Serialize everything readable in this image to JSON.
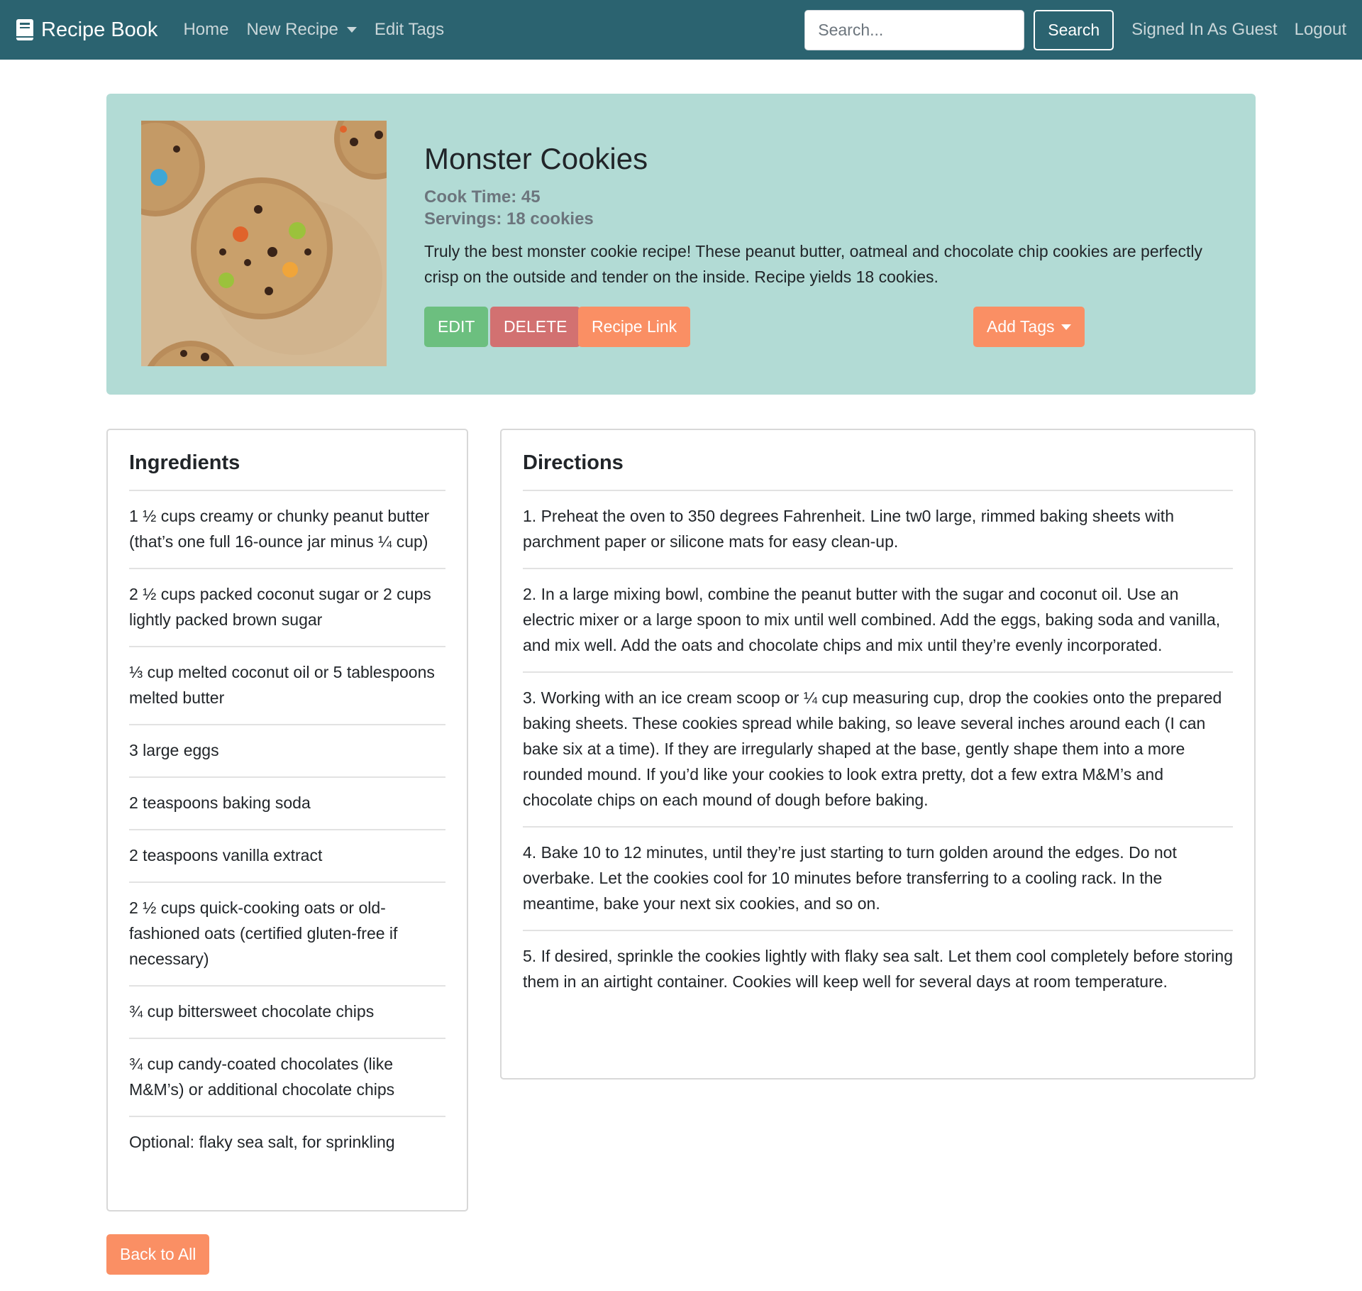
{
  "navbar": {
    "brand": "Recipe Book",
    "brand_icon": "book-icon",
    "links": [
      "Home",
      "New Recipe",
      "Edit Tags"
    ],
    "search_placeholder": "Search...",
    "search_button": "Search",
    "signed_in": "Signed In As Guest",
    "logout": "Logout",
    "colors": {
      "navbar_bg": "#2b6370"
    }
  },
  "recipe": {
    "title": "Monster Cookies",
    "cook_time": "Cook Time: 45",
    "servings": "Servings: 18 cookies",
    "description": "Truly the best monster cookie recipe! These peanut butter, oatmeal and chocolate chip cookies are perfectly crisp on the outside and tender on the inside. Recipe yields 18 cookies.",
    "buttons": {
      "edit": "EDIT",
      "delete": "DELETE",
      "link": "Recipe Link",
      "add_tags": "Add Tags"
    },
    "colors": {
      "panel_bg": "#b2dbd5",
      "edit": "#6cbf7f",
      "delete": "#d27171",
      "accent": "#fa8f64"
    }
  },
  "ingredients": {
    "title": "Ingredients",
    "items": [
      "1 ½ cups creamy or chunky peanut butter (that’s one full 16-ounce jar minus ¼ cup)",
      "2 ½ cups packed coconut sugar or 2 cups lightly packed brown sugar",
      "⅓ cup melted coconut oil or 5 tablespoons melted butter",
      "3 large eggs",
      "2 teaspoons baking soda",
      "2 teaspoons vanilla extract",
      "2 ½ cups quick-cooking oats or old-fashioned oats (certified gluten-free if necessary)",
      "¾ cup bittersweet chocolate chips",
      "¾ cup candy-coated chocolates (like M&M’s) or additional chocolate chips",
      "Optional: flaky sea salt, for sprinkling"
    ]
  },
  "directions": {
    "title": "Directions",
    "items": [
      "1. Preheat the oven to 350 degrees Fahrenheit. Line tw0 large, rimmed baking sheets with parchment paper or silicone mats for easy clean-up.",
      "2. In a large mixing bowl, combine the peanut butter with the sugar and coconut oil. Use an electric mixer or a large spoon to mix until well combined. Add the eggs, baking soda and vanilla, and mix well. Add the oats and chocolate chips and mix until they’re evenly incorporated.",
      "3. Working with an ice cream scoop or ¼ cup measuring cup, drop the cookies onto the prepared baking sheets. These cookies spread while baking, so leave several inches around each (I can bake six at a time). If they are irregularly shaped at the base, gently shape them into a more rounded mound. If you’d like your cookies to look extra pretty, dot a few extra M&M’s and chocolate chips on each mound of dough before baking.",
      "4. Bake 10 to 12 minutes, until they’re just starting to turn golden around the edges. Do not overbake. Let the cookies cool for 10 minutes before transferring to a cooling rack. In the meantime, bake your next six cookies, and so on.",
      "5. If desired, sprinkle the cookies lightly with flaky sea salt. Let them cool completely before storing them in an airtight container. Cookies will keep well for several days at room temperature."
    ]
  },
  "back_button": "Back to All"
}
